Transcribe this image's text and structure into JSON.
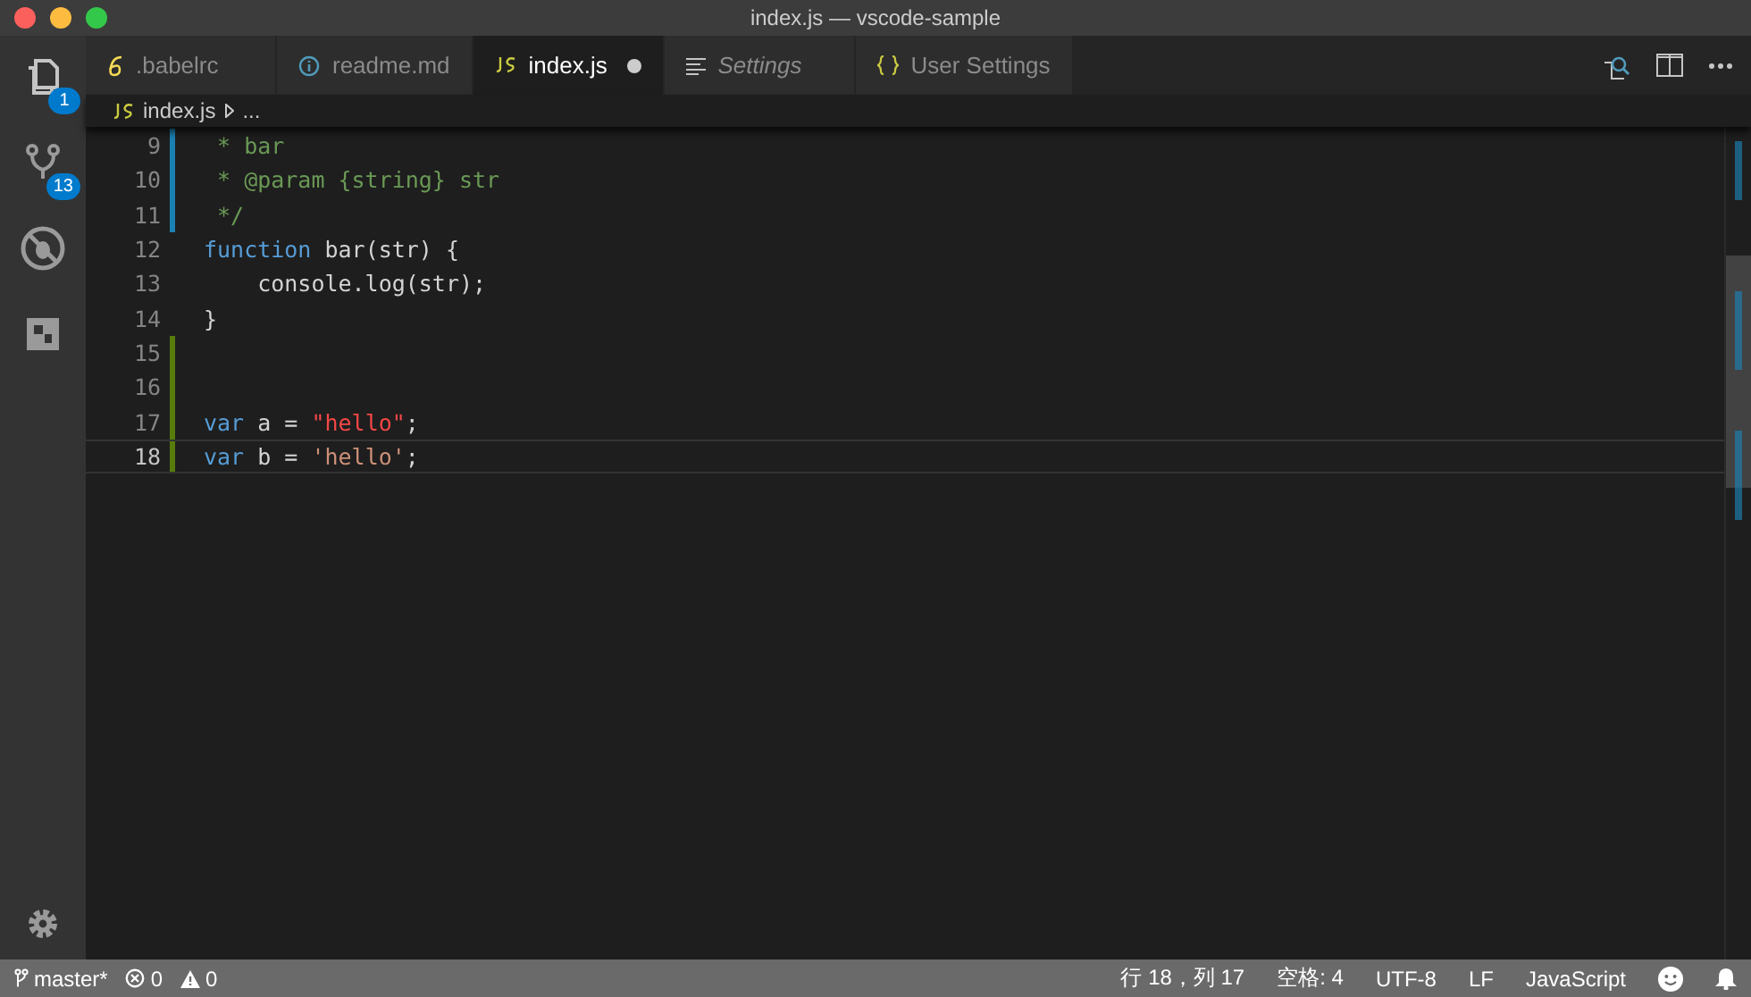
{
  "window": {
    "title": "index.js — vscode-sample"
  },
  "activity_bar": [
    {
      "kind": "files",
      "badge": "1"
    },
    {
      "kind": "git",
      "badge": "13"
    },
    {
      "kind": "debug"
    },
    {
      "kind": "extensions"
    }
  ],
  "tabs": [
    {
      "label": ".babelrc",
      "kind": "babel",
      "selected": false,
      "preview": false,
      "dirty": false
    },
    {
      "label": "readme.md",
      "kind": "info",
      "selected": false,
      "preview": false,
      "dirty": false
    },
    {
      "label": "index.js",
      "kind": "js",
      "selected": true,
      "preview": false,
      "dirty": true
    },
    {
      "label": "Settings",
      "kind": "lines",
      "selected": false,
      "preview": true,
      "dirty": false
    },
    {
      "label": "User Settings",
      "kind": "braces",
      "selected": false,
      "preview": false,
      "dirty": false
    }
  ],
  "breadcrumb": {
    "file": "index.js",
    "rest": "..."
  },
  "editor": {
    "lines": [
      {
        "number": "9",
        "kind": "modified",
        "current": false,
        "tokens": [
          {
            "text": " * bar",
            "kind": "comment"
          }
        ]
      },
      {
        "number": "10",
        "kind": "modified",
        "current": false,
        "tokens": [
          {
            "text": " * @param {string} str",
            "kind": "comment"
          }
        ]
      },
      {
        "number": "11",
        "kind": "modified",
        "current": false,
        "tokens": [
          {
            "text": " */",
            "kind": "comment"
          }
        ]
      },
      {
        "number": "12",
        "kind": "unchanged",
        "current": false,
        "tokens": [
          {
            "text": "function",
            "kind": "keyword"
          },
          {
            "text": " bar(str) {",
            "kind": "plain"
          }
        ]
      },
      {
        "number": "13",
        "kind": "unchanged",
        "current": false,
        "tokens": [
          {
            "text": "    console.log(str);",
            "kind": "plain"
          }
        ]
      },
      {
        "number": "14",
        "kind": "unchanged",
        "current": false,
        "tokens": [
          {
            "text": "}",
            "kind": "plain"
          }
        ]
      },
      {
        "number": "15",
        "kind": "added",
        "current": false
      },
      {
        "number": "16",
        "kind": "added",
        "current": false
      },
      {
        "number": "17",
        "kind": "added",
        "current": false,
        "tokens": [
          {
            "text": "var",
            "kind": "keyword"
          },
          {
            "text": " a = ",
            "kind": "plain"
          },
          {
            "text": "\"hello\"",
            "kind": "error-string"
          },
          {
            "text": ";",
            "kind": "plain"
          }
        ]
      },
      {
        "number": "18",
        "kind": "added",
        "current": true,
        "tokens": [
          {
            "text": "var",
            "kind": "keyword"
          },
          {
            "text": " b = ",
            "kind": "plain"
          },
          {
            "text": "'hello'",
            "kind": "string"
          },
          {
            "text": ";",
            "kind": "plain"
          }
        ]
      }
    ]
  },
  "status_bar": {
    "branch": "master*",
    "errors": "0",
    "warnings": "0",
    "position": "行 18，列 17",
    "indent": "空格: 4",
    "encoding": "UTF-8",
    "eol": "LF",
    "language": "JavaScript"
  }
}
